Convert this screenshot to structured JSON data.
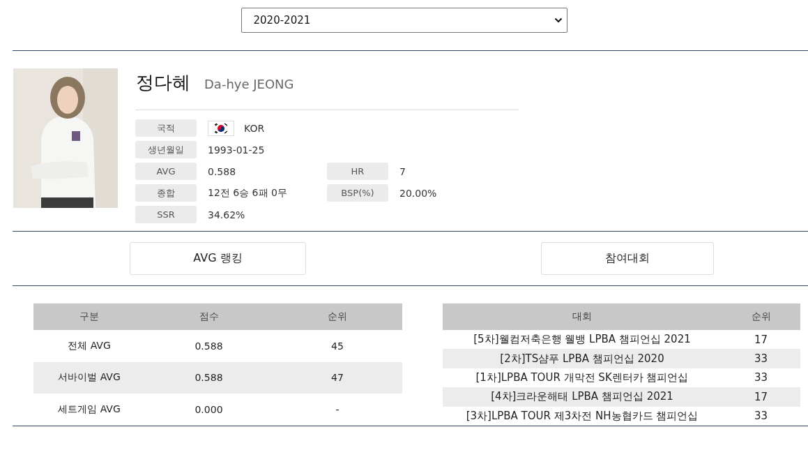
{
  "season_select": {
    "value": "2020-2021"
  },
  "player": {
    "name_ko": "정다혜",
    "name_en": "Da-hye JEONG",
    "info_rows": [
      {
        "cells": [
          {
            "label": "국적",
            "value": "KOR",
            "kind": "flag"
          }
        ]
      },
      {
        "cells": [
          {
            "label": "생년월일",
            "value": "1993-01-25",
            "kind": "text"
          }
        ]
      },
      {
        "cells": [
          {
            "label": "AVG",
            "value": "0.588",
            "kind": "text"
          },
          {
            "label": "HR",
            "value": "7",
            "kind": "text"
          }
        ]
      },
      {
        "cells": [
          {
            "label": "종합",
            "value": "12전 6승 6패 0무",
            "kind": "text"
          },
          {
            "label": "BSP(%)",
            "value": "20.00%",
            "kind": "text"
          }
        ]
      },
      {
        "cells": [
          {
            "label": "SSR",
            "value": "34.62%",
            "kind": "text"
          }
        ]
      }
    ]
  },
  "section_buttons": [
    "AVG 랭킹",
    "참여대회"
  ],
  "avg_table": {
    "columns": [
      "구분",
      "점수",
      "순위"
    ],
    "rows": [
      [
        "전체 AVG",
        "0.588",
        "45"
      ],
      [
        "서바이벌 AVG",
        "0.588",
        "47"
      ],
      [
        "세트게임 AVG",
        "0.000",
        "-"
      ]
    ]
  },
  "tournament_table": {
    "columns": [
      "대회",
      "순위"
    ],
    "rows": [
      [
        "[5차]웰컴저축은행 웰뱅 LPBA 챔피언십 2021",
        "17"
      ],
      [
        "[2차]TS샴푸 LPBA 챔피언십 2020",
        "33"
      ],
      [
        "[1차]LPBA TOUR 개막전 SK렌터카 챔피언십",
        "33"
      ],
      [
        "[4차]크라운해태 LPBA 챔피언십 2021",
        "17"
      ],
      [
        "[3차]LPBA TOUR 제3차전 NH농협카드 챔피언십",
        "33"
      ]
    ]
  }
}
